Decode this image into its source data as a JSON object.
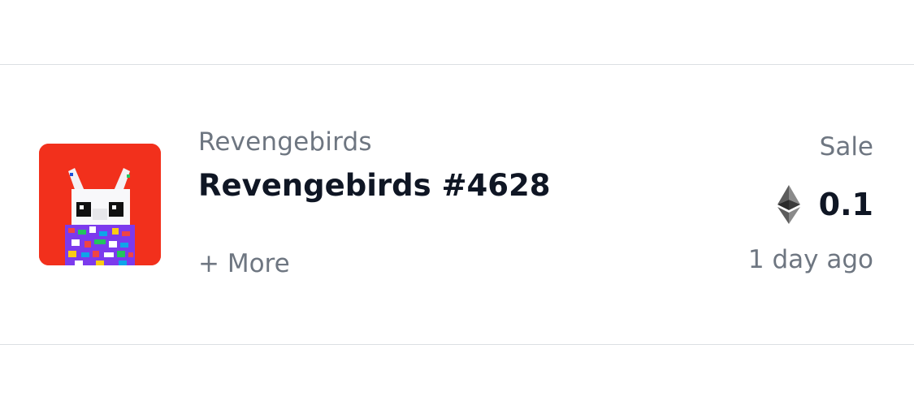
{
  "activity": {
    "collection": "Revengebirds",
    "item_name": "Revengebirds #4628",
    "more_label": "+ More",
    "event_type": "Sale",
    "price": "0.1",
    "currency_icon": "ethereum-icon",
    "time_ago": "1 day ago",
    "thumbnail_icon": "nft-bird-thumbnail",
    "colors": {
      "thumbnail_background": "#f2301c",
      "primary_text": "#0f1624",
      "secondary_text": "#6e7681",
      "divider": "#dcdfe3"
    }
  }
}
